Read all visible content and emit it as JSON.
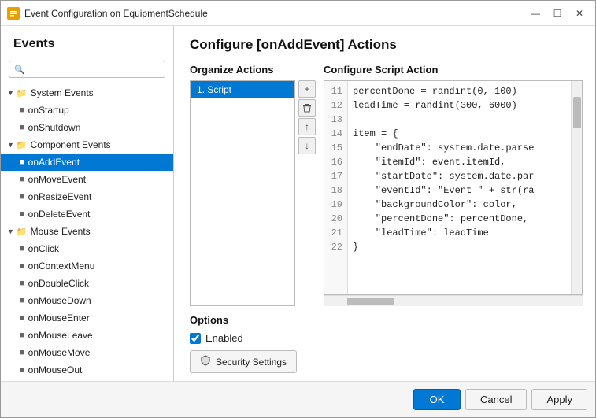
{
  "window": {
    "title": "Event Configuration on EquipmentSchedule",
    "icon": "E"
  },
  "left_panel": {
    "title": "Events",
    "search_placeholder": "Q...",
    "tree": [
      {
        "id": "system-events",
        "label": "System Events",
        "level": 1,
        "type": "group",
        "expanded": true
      },
      {
        "id": "onStartup",
        "label": "onStartup",
        "level": 2,
        "type": "leaf"
      },
      {
        "id": "onShutdown",
        "label": "onShutdown",
        "level": 2,
        "type": "leaf"
      },
      {
        "id": "component-events",
        "label": "Component Events",
        "level": 1,
        "type": "group",
        "expanded": true
      },
      {
        "id": "onAddEvent",
        "label": "onAddEvent",
        "level": 2,
        "type": "leaf",
        "selected": true
      },
      {
        "id": "onMoveEvent",
        "label": "onMoveEvent",
        "level": 2,
        "type": "leaf"
      },
      {
        "id": "onResizeEvent",
        "label": "onResizeEvent",
        "level": 2,
        "type": "leaf"
      },
      {
        "id": "onDeleteEvent",
        "label": "onDeleteEvent",
        "level": 2,
        "type": "leaf"
      },
      {
        "id": "mouse-events",
        "label": "Mouse Events",
        "level": 1,
        "type": "group",
        "expanded": true
      },
      {
        "id": "onClick",
        "label": "onClick",
        "level": 2,
        "type": "leaf"
      },
      {
        "id": "onContextMenu",
        "label": "onContextMenu",
        "level": 2,
        "type": "leaf"
      },
      {
        "id": "onDoubleClick",
        "label": "onDoubleClick",
        "level": 2,
        "type": "leaf"
      },
      {
        "id": "onMouseDown",
        "label": "onMouseDown",
        "level": 2,
        "type": "leaf"
      },
      {
        "id": "onMouseEnter",
        "label": "onMouseEnter",
        "level": 2,
        "type": "leaf"
      },
      {
        "id": "onMouseLeave",
        "label": "onMouseLeave",
        "level": 2,
        "type": "leaf"
      },
      {
        "id": "onMouseMove",
        "label": "onMouseMove",
        "level": 2,
        "type": "leaf"
      },
      {
        "id": "onMouseOut",
        "label": "onMouseOut",
        "level": 2,
        "type": "leaf"
      }
    ]
  },
  "right_panel": {
    "title": "Configure [onAddEvent] Actions",
    "organize_section_title": "Organize Actions",
    "script_section_title": "Configure Script Action",
    "actions_list": [
      {
        "id": "script",
        "label": "1. Script",
        "selected": true
      }
    ],
    "toolbar_buttons": {
      "add": "+",
      "delete": "🗑",
      "up": "↑",
      "down": "↓"
    },
    "code_lines": [
      {
        "num": 11,
        "code": "percentDone = randint(0, 100)"
      },
      {
        "num": 12,
        "code": "leadTime = randint(300, 6000)"
      },
      {
        "num": 13,
        "code": ""
      },
      {
        "num": 14,
        "code": "item = {"
      },
      {
        "num": 15,
        "code": "    \"endDate\": system.date.parse"
      },
      {
        "num": 16,
        "code": "    \"itemId\": event.itemId,"
      },
      {
        "num": 17,
        "code": "    \"startDate\": system.date.par"
      },
      {
        "num": 18,
        "code": "    \"eventId\": \"Event \" + str(ra"
      },
      {
        "num": 19,
        "code": "    \"backgroundColor\": color,"
      },
      {
        "num": 20,
        "code": "    \"percentDone\": percentDone,"
      },
      {
        "num": 21,
        "code": "    \"leadTime\": leadTime"
      },
      {
        "num": 22,
        "code": "}"
      }
    ],
    "options": {
      "title": "Options",
      "enabled_label": "Enabled",
      "enabled_checked": true,
      "security_button_label": "Security Settings"
    }
  },
  "bottom_bar": {
    "ok_label": "OK",
    "cancel_label": "Cancel",
    "apply_label": "Apply"
  }
}
